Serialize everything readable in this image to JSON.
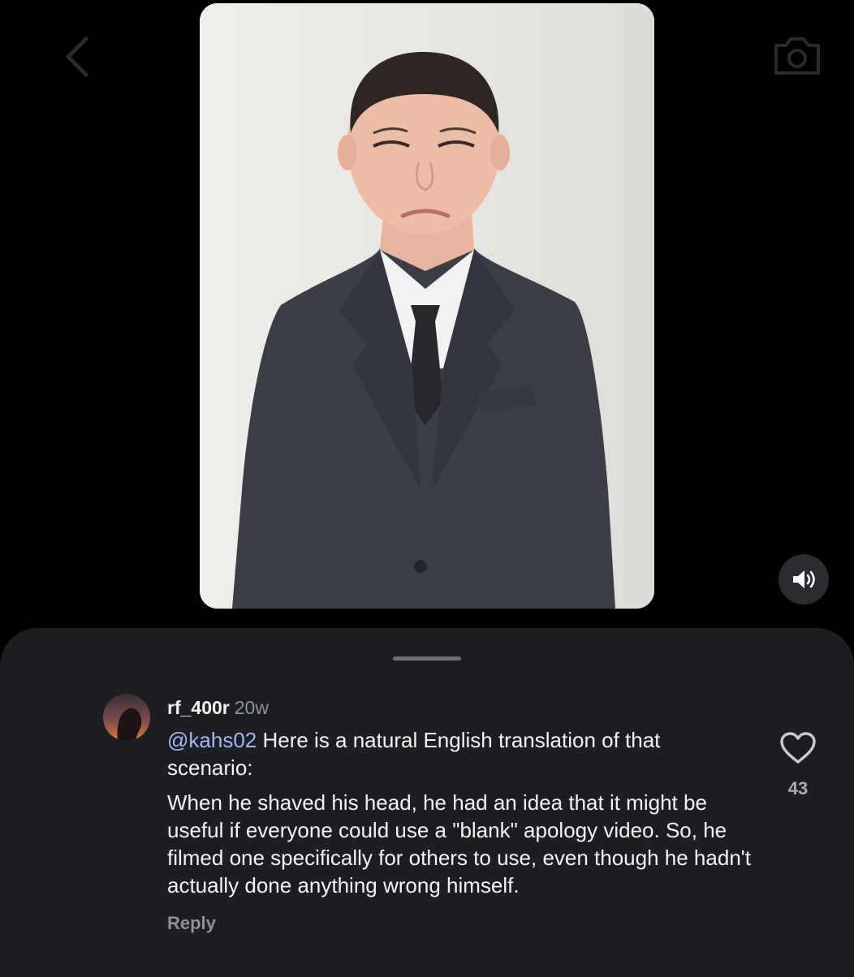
{
  "icons": {
    "back": "chevron-left-icon",
    "camera": "camera-icon",
    "mute": "speaker-icon",
    "like": "heart-icon"
  },
  "comment": {
    "username": "rf_400r",
    "time": "20w",
    "mention": "@kahs02",
    "text_line1": " Here is a natural English translation of that scenario:",
    "text_para2": "When he shaved his head, he had an idea that it might be useful if everyone could use a \"blank\" apology video. So, he filmed one specifically for others to use, even though he hadn't actually done anything wrong himself.",
    "reply_label": "Reply",
    "like_count": "43"
  },
  "colors": {
    "background": "#000000",
    "sheet": "#1c1e22",
    "mention": "#a6b5f3",
    "muted_text": "#8e9196"
  }
}
